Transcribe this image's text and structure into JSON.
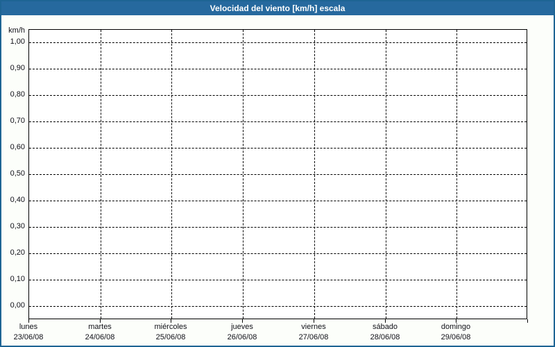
{
  "window": {
    "title": "Velocidad del viento [km/h] escala"
  },
  "colors": {
    "title_bar": "#26699E",
    "page_border": "#1E6494",
    "page_background": "#FCFEFA",
    "plot_background": "#FFFFFF",
    "grid": "#000000",
    "title_text": "#FFFFFF",
    "axis_text": "#101018"
  },
  "chart_data": {
    "type": "line",
    "title": "Velocidad del viento [km/h] escala",
    "ylabel": "km/h",
    "ylim": [
      0,
      1
    ],
    "y_tick_step": 0.1,
    "y_tick_labels": [
      "1,00",
      "0,90",
      "0,80",
      "0,70",
      "0,60",
      "0,50",
      "0,40",
      "0,30",
      "0,20",
      "0,10",
      "0,00"
    ],
    "x_categories": [
      {
        "day": "lunes",
        "date": "23/06/08"
      },
      {
        "day": "martes",
        "date": "24/06/08"
      },
      {
        "day": "miércoles",
        "date": "25/06/08"
      },
      {
        "day": "jueves",
        "date": "26/06/08"
      },
      {
        "day": "viernes",
        "date": "27/06/08"
      },
      {
        "day": "sábado",
        "date": "28/06/08"
      },
      {
        "day": "domingo",
        "date": "29/06/08"
      }
    ],
    "series": [],
    "grid": "dashed",
    "legend": "none",
    "notes": "Empty plot - no wind speed data points are drawn"
  }
}
